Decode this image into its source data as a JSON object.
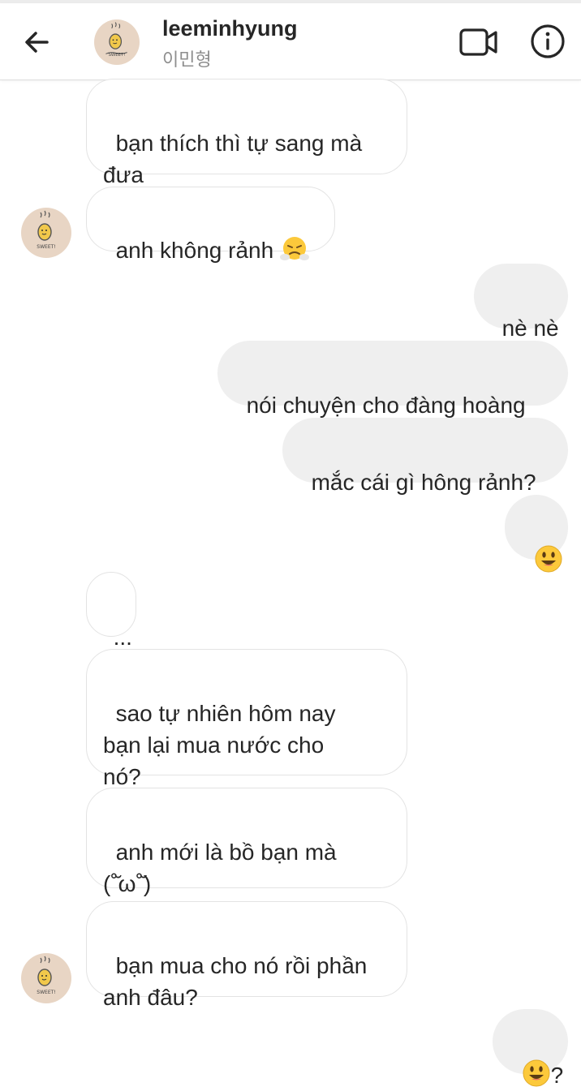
{
  "header": {
    "username": "leeminhyung",
    "subtitle": "이민형",
    "back_icon": "arrow-left-icon",
    "video_icon": "video-call-icon",
    "info_icon": "info-icon"
  },
  "colors": {
    "incoming_bubble_border": "#e3e3e3",
    "outgoing_bubble_bg": "#efefef",
    "avatar_bg": "#e8d5c4",
    "text": "#262626",
    "muted": "#8e8e8e"
  },
  "messages": [
    {
      "side": "in",
      "text": "bạn thích thì tự sang mà\nđưa"
    },
    {
      "side": "in",
      "text": "anh không rảnh ",
      "emoji": "angry-steam-emoji"
    },
    {
      "side": "out",
      "text": "nè nè"
    },
    {
      "side": "out",
      "text": "nói chuyện cho đàng hoàng"
    },
    {
      "side": "out",
      "text": "mắc cái gì hông rảnh?"
    },
    {
      "side": "out",
      "emoji": "smiley-emoji",
      "text": ""
    },
    {
      "side": "in",
      "text": "..."
    },
    {
      "side": "in",
      "text": "sao tự nhiên hôm nay\nbạn lại mua nước cho\nnó?"
    },
    {
      "side": "in",
      "text": "anh mới là bồ bạn mà\n(˚̆ω˚̆)"
    },
    {
      "side": "in",
      "text": "bạn mua cho nó rồi phần\nanh đâu?"
    },
    {
      "side": "out",
      "emoji": "smiley-emoji",
      "text": "?"
    }
  ]
}
